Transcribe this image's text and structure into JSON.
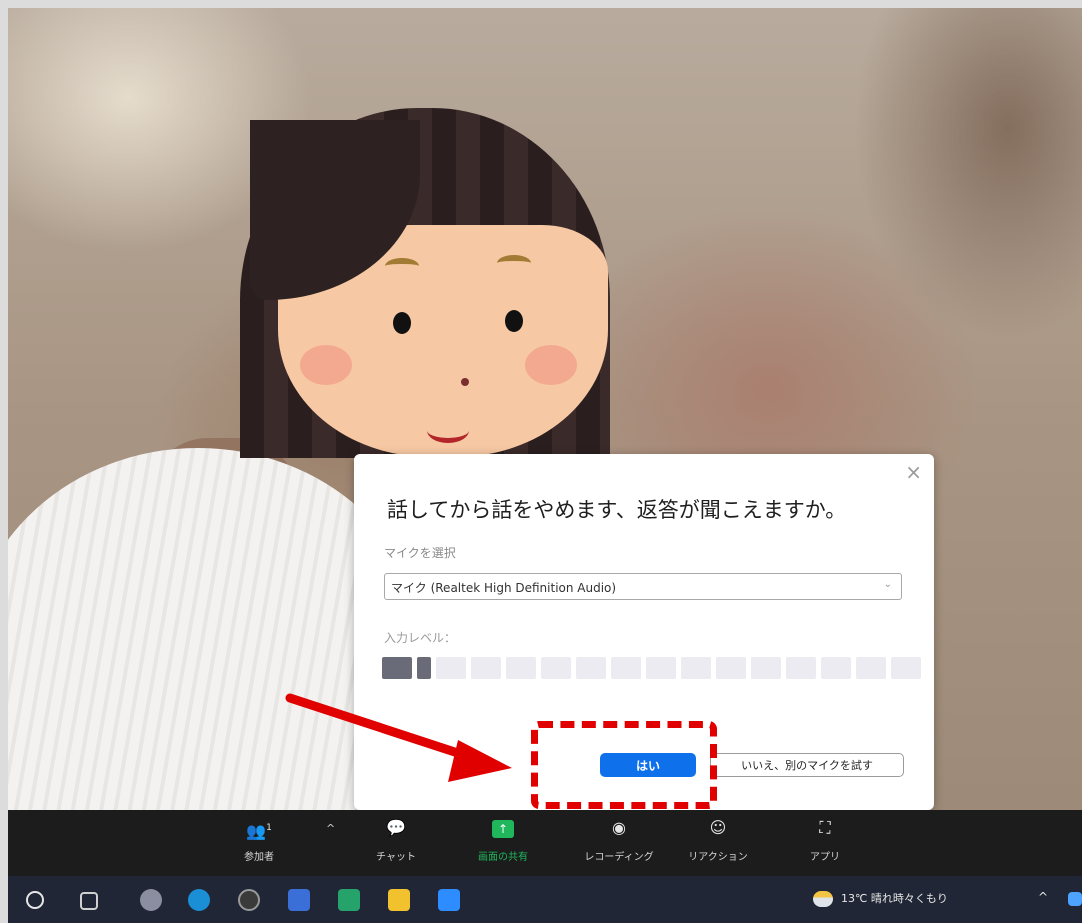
{
  "dialog": {
    "title": "話してから話をやめます、返答が聞こえますか。",
    "mic_label": "マイクを選択",
    "mic_value": "マイク (Realtek High Definition Audio)",
    "input_level_label": "入力レベル：",
    "input_level_segments": 16,
    "input_level_active": 2,
    "yes_button": "はい",
    "no_button": "いいえ、別のマイクを試す",
    "close_icon": "×"
  },
  "toolbar": {
    "participants_label": "参加者",
    "participants_count": "1",
    "chat_label": "チャット",
    "share_label": "画面の共有",
    "record_label": "レコーディング",
    "reactions_label": "リアクション",
    "apps_label": "アプリ"
  },
  "taskbar": {
    "weather": "13℃ 晴れ時々くもり",
    "icons": [
      "start-icon",
      "task-view-icon",
      "paint-icon",
      "edge-icon",
      "obs-icon",
      "calendar-icon",
      "sheets-icon",
      "file-explorer-icon",
      "zoom-icon"
    ]
  },
  "colors": {
    "accent_blue": "#0e71eb",
    "share_green": "#1fb65c",
    "annotation_red": "#e00000",
    "toolbar_bg": "#1c1c1c",
    "taskbar_bg": "#202635"
  }
}
